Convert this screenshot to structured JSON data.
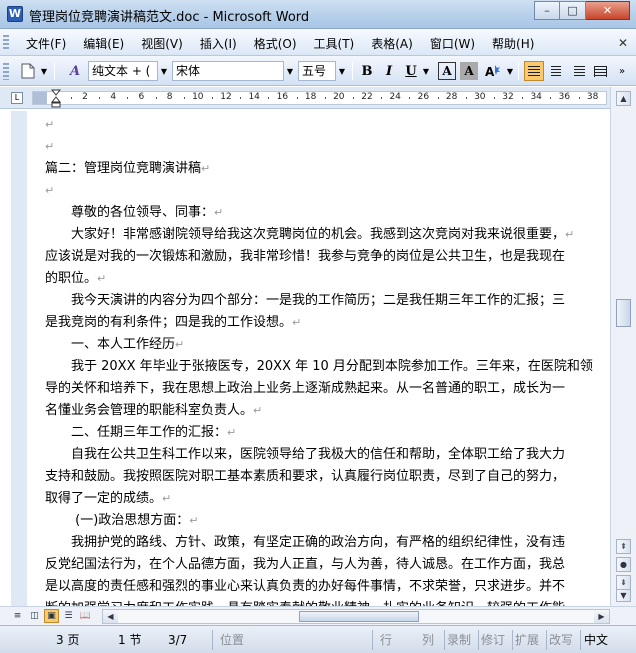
{
  "window": {
    "title": "管理岗位竞聘演讲稿范文.doc - Microsoft Word",
    "app_icon": "W",
    "minimize": "–",
    "maximize": "□",
    "close": "✕"
  },
  "menubar": {
    "items": [
      "文件(F)",
      "编辑(E)",
      "视图(V)",
      "插入(I)",
      "格式(O)",
      "工具(T)",
      "表格(A)",
      "窗口(W)",
      "帮助(H)"
    ],
    "close": "✕"
  },
  "toolbar": {
    "style_value": "纯文本 + (",
    "font_value": "宋体",
    "size_value": "五号",
    "bold": "B",
    "italic": "I",
    "underline": "U",
    "char_border": "A",
    "char_shading": "A"
  },
  "ruler": {
    "ticks": [
      "2",
      "4",
      "6",
      "8",
      "10",
      "12",
      "14",
      "16",
      "18",
      "20",
      "22",
      "24",
      "26",
      "28",
      "30",
      "32",
      "34",
      "36",
      "38"
    ]
  },
  "document": {
    "paragraph_mark": "↵",
    "lines": [
      "",
      "",
      "篇二：管理岗位竞聘演讲稿",
      "",
      "　　尊敬的各位领导、同事：",
      "　　大家好！非常感谢院领导给我这次竞聘岗位的机会。我感到这次竞岗对我来说很重要，",
      "应该说是对我的一次锻炼和激励，我非常珍惜！我参与竞争的岗位是公共卫生，也是我现在",
      "的职位。",
      "　　我今天演讲的内容分为四个部分：一是我的工作简历；二是我任期三年工作的汇报；三",
      "是我竞岗的有利条件；四是我的工作设想。",
      "　　一、本人工作经历",
      "　　我于 20XX 年毕业于张掖医专，20XX 年 10 月分配到本院参加工作。三年来，在医院和领",
      "导的关怀和培养下，我在思想上政治上业务上逐渐成熟起来。从一名普通的职工，成长为一",
      "名懂业务会管理的职能科室负责人。",
      "　　二、任期三年工作的汇报：",
      "　　自我在公共卫生科工作以来，医院领导给了我极大的信任和帮助，全体职工给了我大力",
      "支持和鼓励。我按照医院对职工基本素质和要求，认真履行岗位职责，尽到了自己的努力，",
      "取得了一定的成绩。",
      "　　 (一)政治思想方面：",
      "　　我拥护党的路线、方针、政策，有坚定正确的政治方向，有严格的组织纪律性，没有违",
      "反党纪国法行为，在个人品德方面，我为人正直，与人为善，待人诚恳。在工作方面，我总",
      "是以高度的责任感和强烈的事业心来认真负责的办好每件事情，不求荣誉，只求进步。并不",
      "断的加强学习力度和工作实践，具有踏实奉献的敬业精神，扎实的业务知识，较强的工作能"
    ],
    "marked": [
      true,
      true,
      true,
      true,
      true,
      true,
      false,
      true,
      false,
      true,
      true,
      false,
      false,
      true,
      true,
      false,
      false,
      true,
      true,
      false,
      false,
      false,
      false
    ]
  },
  "statusbar": {
    "page": "3 页",
    "section": "1 节",
    "page_of": "3/7",
    "position": "位置",
    "line": "行",
    "column": "列",
    "record": "录制",
    "revise": "修订",
    "extend": "扩展",
    "overtype": "改写",
    "language": "中文"
  }
}
